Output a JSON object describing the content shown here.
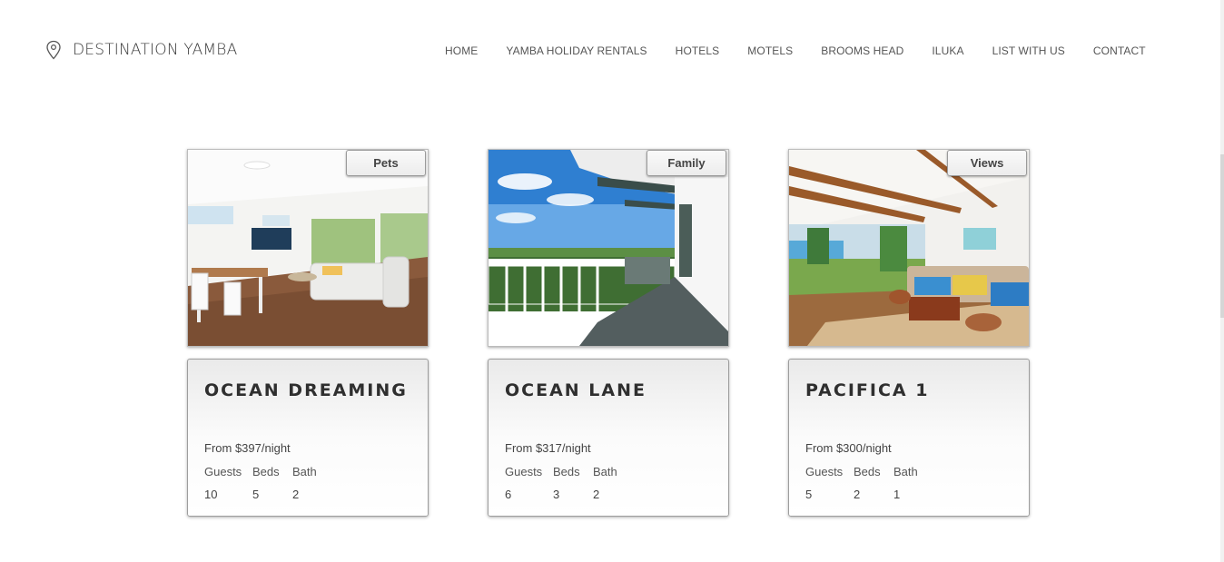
{
  "brand": {
    "name": "DESTINATION YAMBA",
    "icon": "location-pin-icon"
  },
  "nav": {
    "items": [
      "HOME",
      "YAMBA HOLIDAY RENTALS",
      "HOTELS",
      "MOTELS",
      "BROOMS HEAD",
      "ILUKA",
      "LIST WITH US",
      "CONTACT"
    ]
  },
  "stat_labels": {
    "guests": "Guests",
    "beds": "Beds",
    "bath": "Bath"
  },
  "listings": [
    {
      "tag": "Pets",
      "title": "OCEAN DREAMING",
      "price": "From $397/night",
      "guests": "10",
      "beds": "5",
      "bath": "2"
    },
    {
      "tag": "Family",
      "title": "OCEAN LANE",
      "price": "From $317/night",
      "guests": "6",
      "beds": "3",
      "bath": "2"
    },
    {
      "tag": "Views",
      "title": "PACIFICA 1",
      "price": "From $300/night",
      "guests": "5",
      "beds": "2",
      "bath": "1"
    }
  ]
}
